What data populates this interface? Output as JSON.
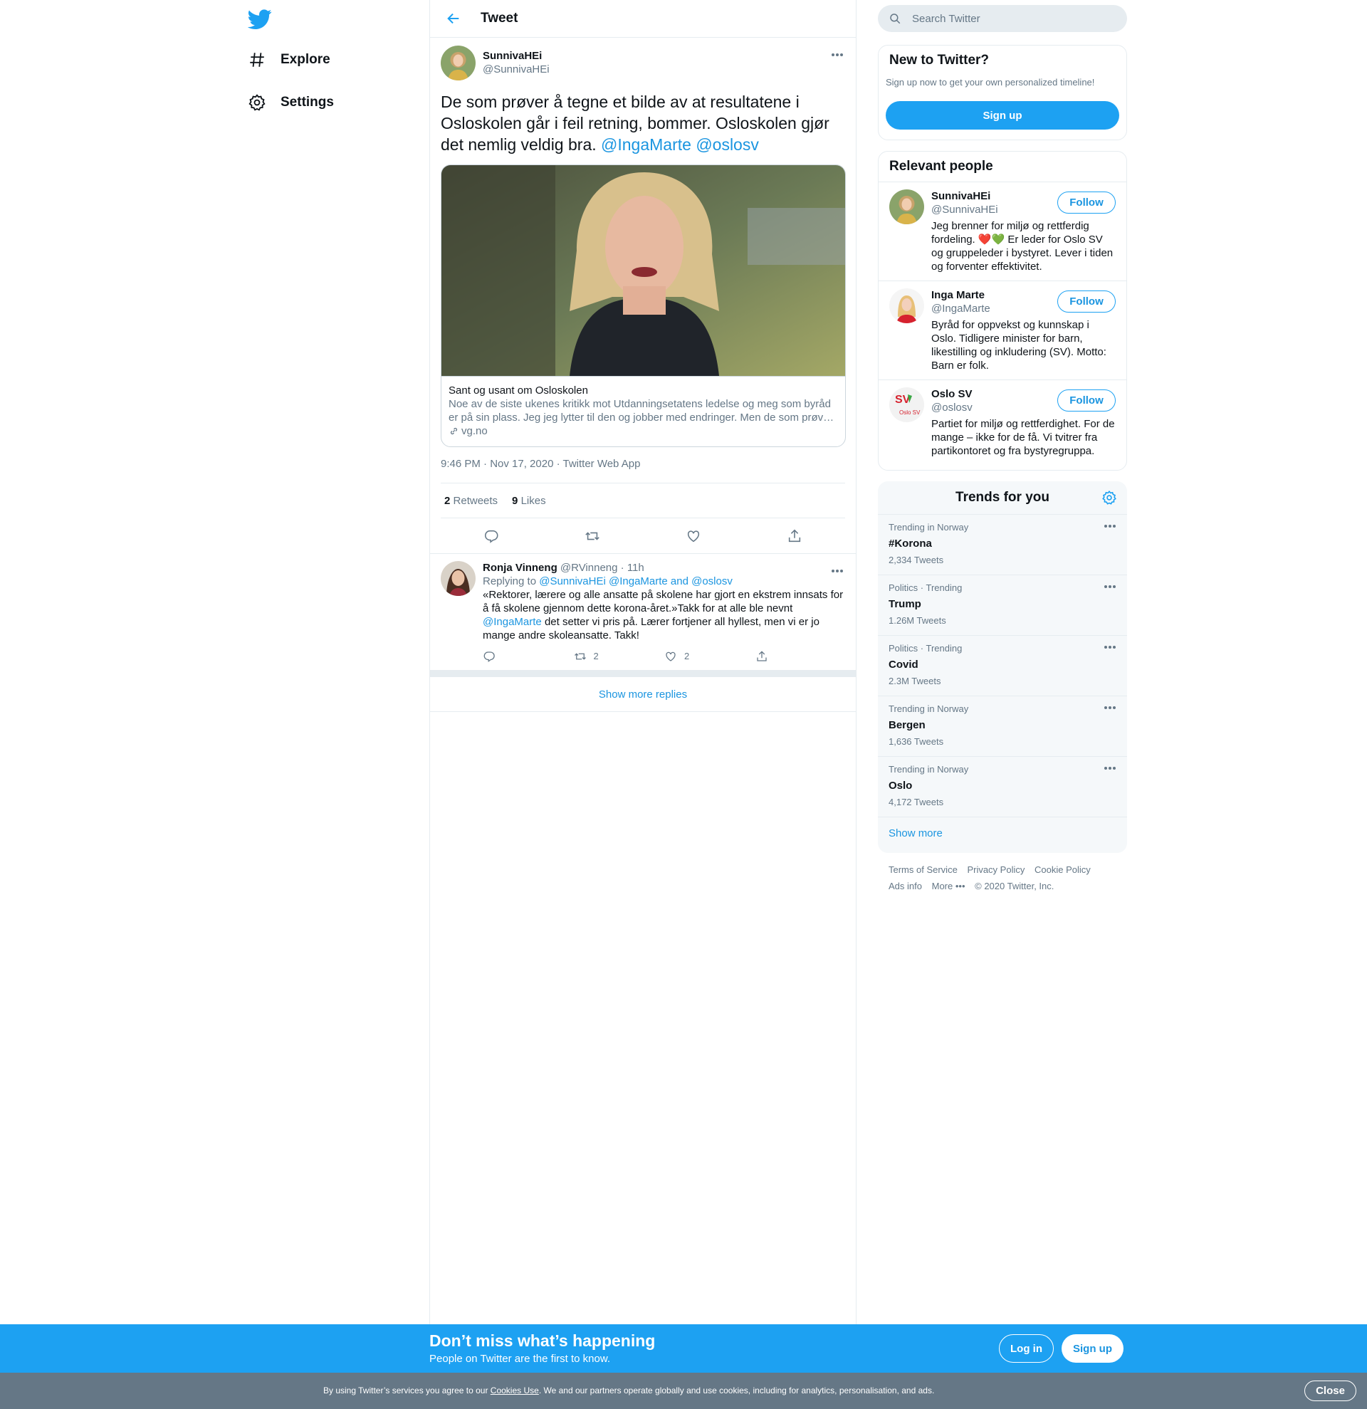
{
  "colors": {
    "brand": "#1da1f2",
    "link": "#1b95e0",
    "muted": "#657786",
    "border": "#e6ecf0"
  },
  "nav": {
    "items": [
      {
        "label": "Explore",
        "icon": "hashtag-icon"
      },
      {
        "label": "Settings",
        "icon": "gear-icon"
      }
    ]
  },
  "header": {
    "title": "Tweet"
  },
  "tweet": {
    "author_name": "SunnivaHEi",
    "author_handle": "@SunnivaHEi",
    "text": "De som prøver å tegne et bilde av at resultatene i Osloskolen går i feil retning, bommer. Osloskolen gjør det nemlig veldig bra.",
    "mention1": "@IngaMarte",
    "mention2": "@oslosv",
    "card": {
      "title": "Sant og usant om Osloskolen",
      "description": "Noe av de siste ukenes kritikk mot Utdanningsetatens ledelse og meg som byråd er på sin plass. Jeg jeg lytter til den og jobber med endringer. Men de som prøv…",
      "domain": "vg.no"
    },
    "timestamp": "9:46 PM · Nov 17, 2020 · Twitter Web App",
    "retweets_count": "2",
    "retweets_label": "Retweets",
    "likes_count": "9",
    "likes_label": "Likes"
  },
  "reply": {
    "name": "Ronja Vinneng",
    "handle": "@RVinneng",
    "time": "· 11h",
    "replying_prefix": "Replying to",
    "replying_targets": "@SunnivaHEi @IngaMarte and @oslosv",
    "text_part1": "«Rektorer, lærere og alle ansatte på skolene har gjort en ekstrem innsats for å få skolene gjennom dette korona-året.»Takk for at alle ble nevnt",
    "text_mention": "@IngaMarte",
    "text_part2": "det setter vi pris på. Lærer fortjener all hyllest, men vi er jo mange andre skoleansatte. Takk!",
    "retweet_count": "2",
    "like_count": "2"
  },
  "show_more_replies": "Show more replies",
  "search": {
    "placeholder": "Search Twitter"
  },
  "new_to_twitter": {
    "title": "New to Twitter?",
    "subtitle": "Sign up now to get your own personalized timeline!",
    "button": "Sign up"
  },
  "relevant_people": {
    "title": "Relevant people",
    "follow_label": "Follow",
    "people": [
      {
        "name": "SunnivaHEi",
        "handle": "@SunnivaHEi",
        "bio": "Jeg brenner for miljø og rettferdig fordeling. ❤️💚 Er leder for Oslo SV og gruppeleder i bystyret. Lever i tiden og forventer effektivitet."
      },
      {
        "name": "Inga Marte",
        "handle": "@IngaMarte",
        "bio": "Byråd for oppvekst og kunnskap i Oslo. Tidligere minister for barn, likestilling og inkludering (SV). Motto: Barn er folk."
      },
      {
        "name": "Oslo SV",
        "handle": "@oslosv",
        "bio": "Partiet for miljø og rettferdighet. For de mange – ikke for de få. Vi tvitrer fra partikontoret og fra bystyregruppa.",
        "logo_text": "SV",
        "logo_sub": "Oslo SV"
      }
    ]
  },
  "trends": {
    "title": "Trends for you",
    "items": [
      {
        "context": "Trending in Norway",
        "name": "#Korona",
        "count": "2,334 Tweets"
      },
      {
        "context": "Politics · Trending",
        "name": "Trump",
        "count": "1.26M Tweets"
      },
      {
        "context": "Politics · Trending",
        "name": "Covid",
        "count": "2.3M Tweets"
      },
      {
        "context": "Trending in Norway",
        "name": "Bergen",
        "count": "1,636 Tweets"
      },
      {
        "context": "Trending in Norway",
        "name": "Oslo",
        "count": "4,172 Tweets"
      }
    ],
    "show_more": "Show more"
  },
  "footer": {
    "terms": "Terms of Service",
    "privacy": "Privacy Policy",
    "cookie": "Cookie Policy",
    "ads": "Ads info",
    "more": "More",
    "copyright": "© 2020 Twitter, Inc."
  },
  "bottom_bar": {
    "title": "Don’t miss what’s happening",
    "subtitle": "People on Twitter are the first to know.",
    "login": "Log in",
    "signup": "Sign up"
  },
  "cookie_bar": {
    "text_before": "By using Twitter’s services you agree to our",
    "link": "Cookies Use",
    "text_after": ". We and our partners operate globally and use cookies, including for analytics, personalisation, and ads.",
    "close": "Close"
  }
}
